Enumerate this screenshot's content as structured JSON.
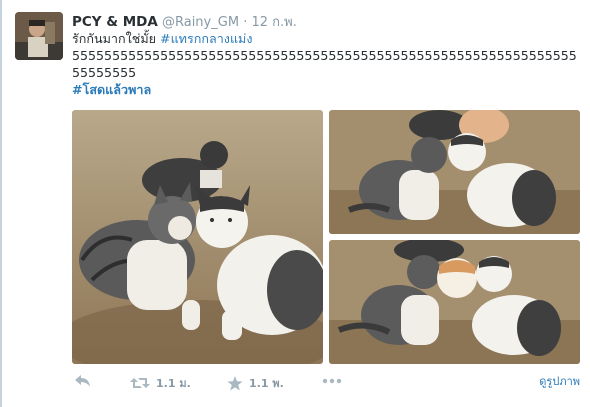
{
  "tweet": {
    "fullname": "PCY & MDA",
    "username": "@Rainy_GM",
    "separator": "·",
    "time": "12 ก.พ.",
    "text_line1_prefix": "รักกันมากใช่มั้ย ",
    "hashtag1": "#แทรกกลางแม่ง",
    "text_line2": "555555555555555555555555555555555555555555555555555555555555555",
    "text_line3": "55555555",
    "hashtag2": "#โสดแล้วพาล"
  },
  "actions": {
    "reply_icon": "reply-arrow-icon",
    "retweet_icon": "retweet-icon",
    "retweet_count": "1.1 ม.",
    "favorite_icon": "star-icon",
    "favorite_count": "1.1 พ.",
    "more_icon": "more-dots-icon",
    "view_photo_label": "ดูรูปภาพ"
  },
  "colors": {
    "link": "#2b7bb9",
    "muted": "#8899a6",
    "text": "#292f33"
  }
}
